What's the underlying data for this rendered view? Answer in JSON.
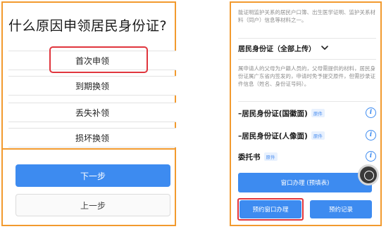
{
  "left": {
    "title": "什么原因申领居民身份证?",
    "options": [
      {
        "label": "首次申领"
      },
      {
        "label": "到期换领"
      },
      {
        "label": "丢失补领"
      },
      {
        "label": "损坏换领"
      }
    ],
    "next_label": "下一步",
    "prev_label": "上一步"
  },
  "right": {
    "top_note": "能证明监护关系的居民户口簿、出生医学证明、监护关系材料（同户）信息等材料之一。",
    "section_title": "居民身份证（全部上传）",
    "section_desc": "属申请人的父母为户籍人员的，父母需提供的材料，居民身份证属广东省内签发的，申请时免予提交原件，但需抄录证件信息（姓名、身份证号码）。",
    "docs": [
      {
        "label": "–居民身份证(国徽面)",
        "badge": "原件",
        "info_icon": "info-icon"
      },
      {
        "label": "–居民身份证(人像面)",
        "badge": "原件",
        "info_icon": "info-icon"
      },
      {
        "label": "委托书",
        "badge": "原件",
        "info_icon": "info-icon"
      }
    ],
    "window_btn_label": "窗口办理 (预填表)",
    "reserve_btn_label": "预约窗口办理",
    "records_btn_label": "预约记录"
  },
  "colors": {
    "accent": "#3d8bf0",
    "highlight": "#e0353d",
    "frame": "#f29a2e"
  }
}
